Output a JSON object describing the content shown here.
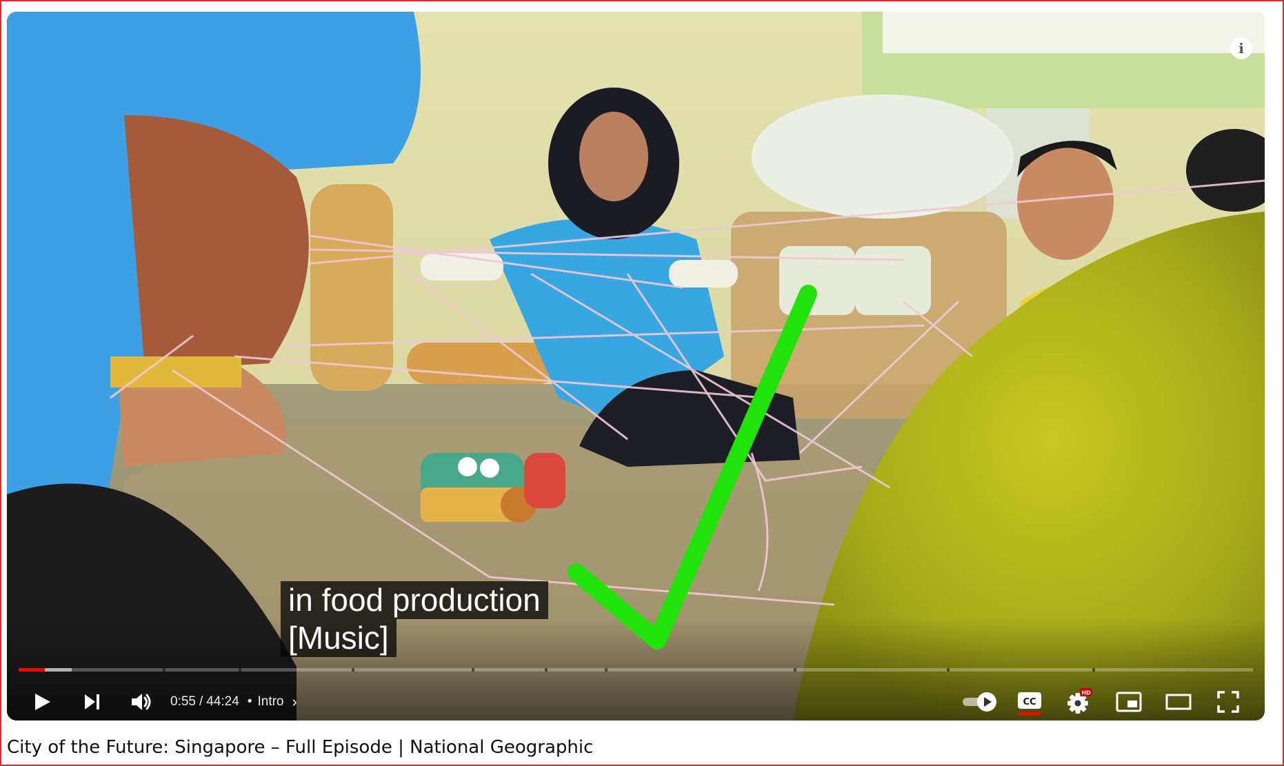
{
  "player": {
    "captions": [
      "in food production",
      "[Music]"
    ],
    "time": {
      "current": "0:55",
      "separator": "/",
      "duration": "44:24"
    },
    "chapter": {
      "dot": "•",
      "title": "Intro",
      "chevron": "›"
    },
    "progress": {
      "played_fraction": 0.021,
      "loaded_fraction": 0.043
    },
    "chapter_markers_fraction": [
      0.117,
      0.178,
      0.27,
      0.367,
      0.426,
      0.475,
      0.628,
      0.752,
      0.87
    ],
    "controls": {
      "play": "play-icon",
      "next": "next-icon",
      "volume": "volume-icon",
      "autoplay": "autoplay-toggle-icon",
      "captions": "cc-icon",
      "settings": "gear-icon",
      "settings_badge": "HD",
      "miniplayer": "miniplayer-icon",
      "theater": "theater-mode-icon",
      "fullscreen": "fullscreen-icon"
    },
    "info_icon": "i"
  },
  "video": {
    "title": "City of the Future: Singapore – Full Episode | National Geographic"
  },
  "colors": {
    "progress": "#ff0000",
    "checkmark": "#22e20b",
    "frame_border": "#d32f2f"
  }
}
